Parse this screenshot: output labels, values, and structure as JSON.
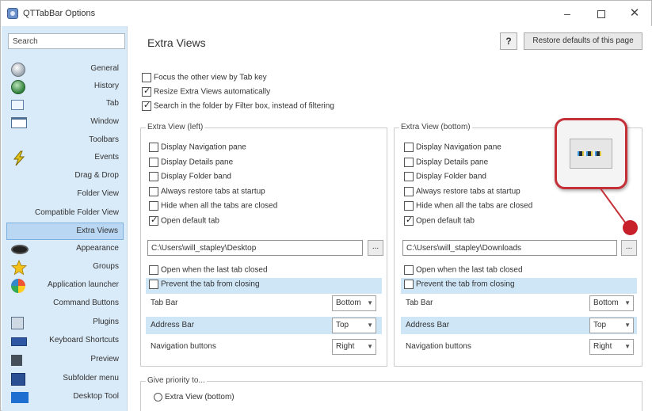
{
  "window": {
    "title": "QTTabBar Options",
    "minimize": "–",
    "close": "✕"
  },
  "sidebar": {
    "search_value": "Search",
    "items": [
      {
        "label": "General",
        "icon": "globe-gray-icon"
      },
      {
        "label": "History",
        "icon": "history-icon"
      },
      {
        "label": "Tab",
        "icon": "tab-icon"
      },
      {
        "label": "Window",
        "icon": "window-icon"
      },
      {
        "label": "Toolbars",
        "icon": ""
      },
      {
        "label": "Events",
        "icon": "lightning-icon"
      },
      {
        "label": "Drag & Drop",
        "icon": ""
      },
      {
        "label": "Folder View",
        "icon": ""
      },
      {
        "label": "Compatible Folder View",
        "icon": ""
      },
      {
        "label": "Extra Views",
        "icon": ""
      },
      {
        "label": "Appearance",
        "icon": "eye-icon"
      },
      {
        "label": "Groups",
        "icon": "star-icon"
      },
      {
        "label": "Application launcher",
        "icon": "app-launcher-icon"
      },
      {
        "label": "Command Buttons",
        "icon": ""
      },
      {
        "label": "Plugins",
        "icon": "plugin-icon"
      },
      {
        "label": "Keyboard Shortcuts",
        "icon": "keyboard-icon"
      },
      {
        "label": "Preview",
        "icon": "preview-icon"
      },
      {
        "label": "Subfolder menu",
        "icon": "subfolder-icon"
      },
      {
        "label": "Desktop Tool",
        "icon": "desktop-icon"
      }
    ],
    "active": "Extra Views"
  },
  "main": {
    "title": "Extra Views",
    "help_label": "?",
    "restore_label": "Restore defaults of this page",
    "top_options": [
      {
        "label": "Focus the other view by Tab key",
        "checked": false
      },
      {
        "label": "Resize Extra Views automatically",
        "checked": true
      },
      {
        "label": "Search in the folder by Filter box, instead of filtering",
        "checked": true
      }
    ],
    "left_panel": {
      "title": "Extra View (left)",
      "options": [
        {
          "label": "Display Navigation pane",
          "checked": false
        },
        {
          "label": "Display Details pane",
          "checked": false
        },
        {
          "label": "Display Folder band",
          "checked": false
        },
        {
          "label": "Always restore tabs at startup",
          "checked": false
        },
        {
          "label": "Hide when all the tabs are closed",
          "checked": false
        },
        {
          "label": "Open default tab",
          "checked": true
        }
      ],
      "path": "C:\\Users\\will_stapley\\Desktop",
      "browse_label": "...",
      "open_when_closed": "Open when the last tab closed",
      "prevent_closing": "Prevent the tab from closing",
      "settings": [
        {
          "label": "Tab Bar",
          "value": "Bottom"
        },
        {
          "label": "Address Bar",
          "value": "Top"
        },
        {
          "label": "Navigation buttons",
          "value": "Right"
        }
      ]
    },
    "right_panel": {
      "title": "Extra View (bottom)",
      "options": [
        {
          "label": "Display Navigation pane",
          "checked": false
        },
        {
          "label": "Display Details pane",
          "checked": false
        },
        {
          "label": "Display Folder band",
          "checked": false
        },
        {
          "label": "Always restore tabs at startup",
          "checked": false
        },
        {
          "label": "Hide when all the tabs are closed",
          "checked": false
        },
        {
          "label": "Open default tab",
          "checked": true
        }
      ],
      "path": "C:\\Users\\will_stapley\\Downloads",
      "browse_label": "...",
      "open_when_closed": "Open when the last tab closed",
      "prevent_closing": "Prevent the tab from closing",
      "settings": [
        {
          "label": "Tab Bar",
          "value": "Bottom"
        },
        {
          "label": "Address Bar",
          "value": "Top"
        },
        {
          "label": "Navigation buttons",
          "value": "Right"
        }
      ]
    },
    "priority": {
      "title": "Give priority to...",
      "option": "Extra View (bottom)"
    }
  },
  "colors": {
    "sidebar_bg": "#d9eaf8",
    "highlight_row": "#cfe6f7",
    "callout_red": "#c53038"
  }
}
